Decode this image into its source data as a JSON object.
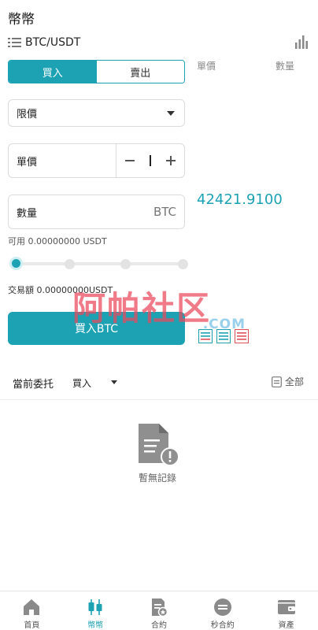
{
  "header": {
    "title": "幣幣"
  },
  "pair": {
    "name": "BTC/USDT",
    "list_icon": "list-icon",
    "chart_icon": "bar-chart-icon"
  },
  "tabs": [
    {
      "label": "買入",
      "active": true
    },
    {
      "label": "賣出",
      "active": false
    }
  ],
  "orderbook": {
    "price_header": "單價",
    "amount_header": "數量",
    "last_price": "42421.9100"
  },
  "order_type": {
    "selected": "限價"
  },
  "price_field": {
    "label": "單價"
  },
  "amount_field": {
    "label": "數量",
    "unit": "BTC"
  },
  "available": "可用 0.00000000 USDT",
  "slider": {
    "value_percent": 0,
    "stops": [
      0,
      25,
      50,
      75,
      100
    ]
  },
  "trade_amount": "交易額 0.00000000USDT",
  "buy_button": {
    "label": "買入BTC"
  },
  "current_orders": {
    "title": "當前委托",
    "filter": "買入",
    "all_label": "全部"
  },
  "empty_state": {
    "text": "暫無記錄"
  },
  "watermark": {
    "text": "阿帕社区",
    "sub": ".COM"
  },
  "nav": [
    {
      "label": "首頁",
      "icon": "home-icon",
      "active": false
    },
    {
      "label": "幣幣",
      "icon": "candlestick-icon",
      "active": true
    },
    {
      "label": "合約",
      "icon": "contract-icon",
      "active": false
    },
    {
      "label": "秒合約",
      "icon": "seconds-contract-icon",
      "active": false
    },
    {
      "label": "資產",
      "icon": "wallet-icon",
      "active": false
    }
  ],
  "colors": {
    "accent": "#1da2b4",
    "sell": "#e0505a"
  }
}
